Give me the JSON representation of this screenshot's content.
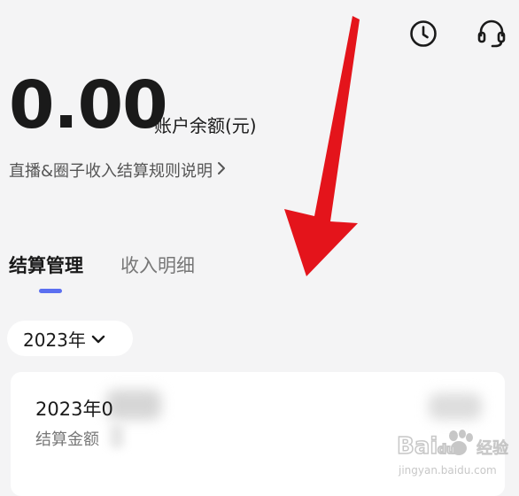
{
  "header": {
    "history_icon": "clock-icon",
    "service_icon": "headset-icon"
  },
  "balance": {
    "amount": "0.00",
    "label": "账户余额(元)"
  },
  "rules_link": {
    "text": "直播&圈子收入结算规则说明",
    "chevron": "›"
  },
  "tabs": [
    {
      "label": "结算管理",
      "active": true
    },
    {
      "label": "收入明细",
      "active": false
    }
  ],
  "year_selector": {
    "value": "2023年",
    "icon": "chevron-down-icon"
  },
  "card": {
    "period": "2023年0",
    "label": "结算金额"
  },
  "watermark": {
    "logo_text": "Baidu经验",
    "url": "jingyan.baidu.com"
  },
  "colors": {
    "accent": "#5b6ff0",
    "arrow": "#e4141b",
    "background": "#f4f4f5",
    "card": "#ffffff"
  }
}
